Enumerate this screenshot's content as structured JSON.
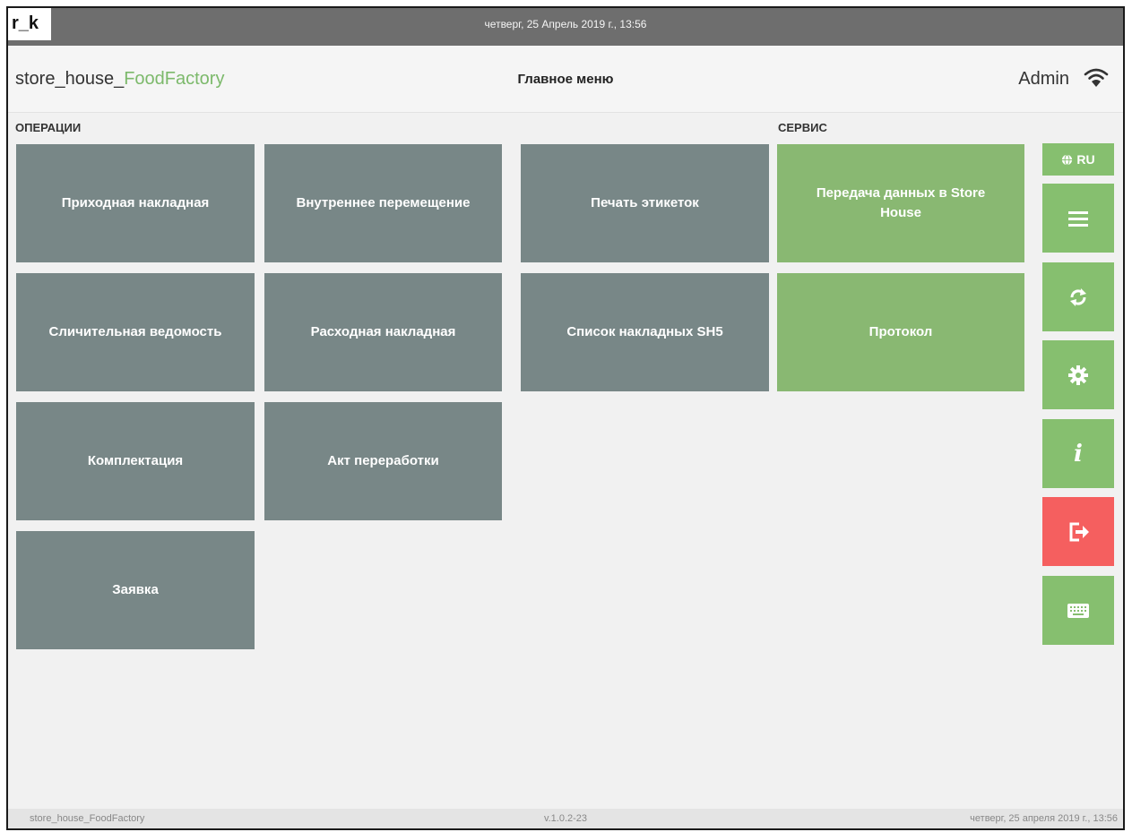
{
  "topbar": {
    "logo": "r_k",
    "datetime": "четверг, 25 Апрель 2019 г., 13:56"
  },
  "header": {
    "app_name_prefix": "store_house_",
    "app_name_accent": "FoodFactory",
    "title": "Главное меню",
    "user": "Admin",
    "status_icon": "wifi-icon"
  },
  "sections": {
    "operations": "ОПЕРАЦИИ",
    "service": "СЕРВИС"
  },
  "tiles": {
    "incoming_invoice": "Приходная накладная",
    "internal_transfer": "Внутреннее перемещение",
    "label_print": "Печать этикеток",
    "data_transfer": "Передача данных в Store House",
    "inventory_sheet": "Сличительная ведомость",
    "outgoing_invoice": "Расходная накладная",
    "invoice_list": "Список накладных SH5",
    "log": "Протокол",
    "assembly": "Комплектация",
    "processing_act": "Акт переработки",
    "request": "Заявка"
  },
  "side": {
    "lang": "RU",
    "icons": [
      "globe-icon",
      "menu-icon",
      "sync-icon",
      "gear-icon",
      "info-icon",
      "logout-icon",
      "keyboard-icon"
    ]
  },
  "footer": {
    "left": "store_house_FoodFactory",
    "center": "v.1.0.2-23",
    "right": "четверг, 25 апреля 2019 г., 13:56"
  },
  "colors": {
    "tile_gray": "#788787",
    "tile_green": "#89b872",
    "side_green": "#86bf6f",
    "logout_red": "#f55f5f",
    "accent": "#7cb96b"
  }
}
